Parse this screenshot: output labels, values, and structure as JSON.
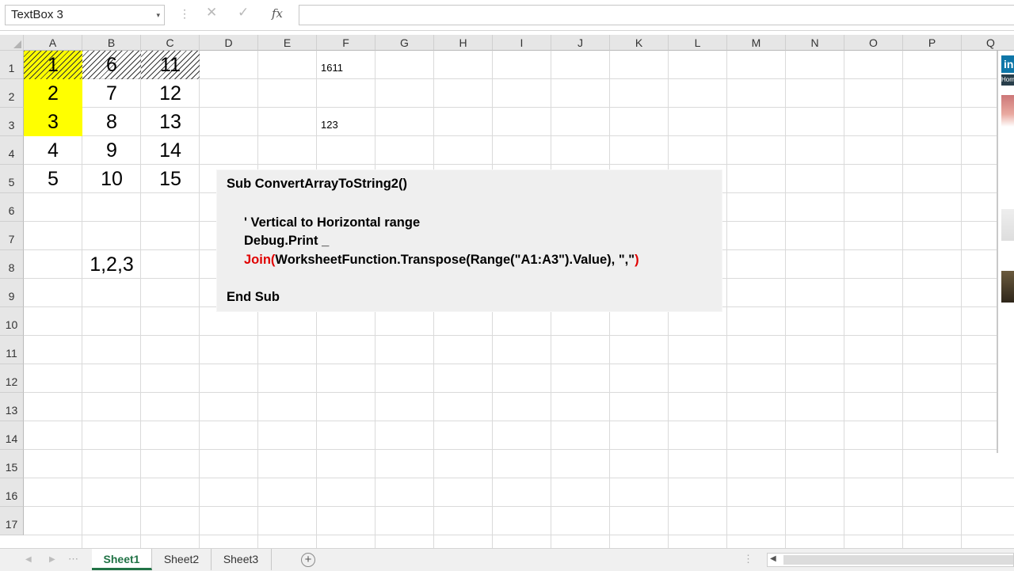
{
  "formula_bar": {
    "name_box": "TextBox 3",
    "name_box_arrow": "▾",
    "dots": "⋮",
    "cancel_icon": "✕",
    "enter_icon": "✓",
    "function_icon": "fx",
    "formula": ""
  },
  "columns": [
    "A",
    "B",
    "C",
    "D",
    "E",
    "F",
    "G",
    "H",
    "I",
    "J",
    "K",
    "L",
    "M",
    "N",
    "O",
    "P",
    "Q"
  ],
  "rows": [
    "1",
    "2",
    "3",
    "4",
    "5",
    "6",
    "7",
    "8",
    "9",
    "10",
    "11",
    "12",
    "13",
    "14",
    "15",
    "16",
    "17"
  ],
  "cells": {
    "A1": "1",
    "B1": "6",
    "C1": "11",
    "A2": "2",
    "B2": "7",
    "C2": "12",
    "A3": "3",
    "B3": "8",
    "C3": "13",
    "A4": "4",
    "B4": "9",
    "C4": "14",
    "A5": "5",
    "B5": "10",
    "C5": "15",
    "B8": "1,2,3",
    "F1": "1611",
    "F3": "123"
  },
  "textbox": {
    "line1": "Sub ConvertArrayToString2()",
    "line2": "' Vertical to Horizontal range",
    "line3": "Debug.Print _",
    "line4_keyword": "Join(",
    "line4_body": "WorksheetFunction.Transpose(Range(\"A1:A3\").Value), \",\"",
    "line4_close": ")",
    "line5": "End Sub"
  },
  "side_panel": {
    "logo": "in",
    "bar_label": "Hom"
  },
  "sheet_tabs": [
    "Sheet1",
    "Sheet2",
    "Sheet3"
  ],
  "active_sheet": "Sheet1",
  "add_sheet_label": "+",
  "colors": {
    "highlight": "#ffff00",
    "active_tab": "#217346",
    "code_red": "#e00000"
  }
}
